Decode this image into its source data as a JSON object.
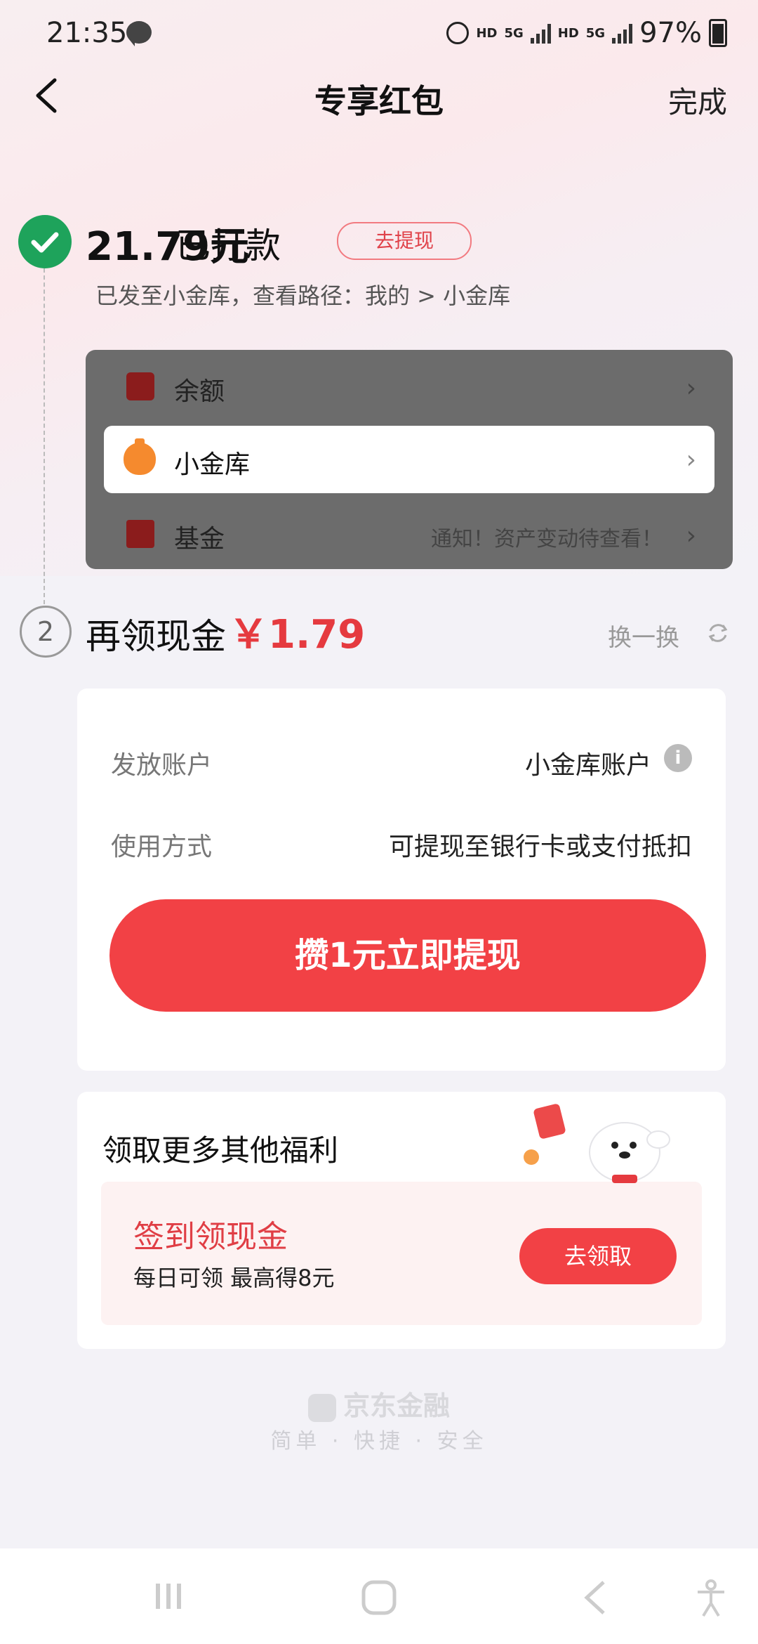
{
  "status_bar": {
    "time": "21:35",
    "hd1": "HD",
    "net1": "5G",
    "hd2": "HD",
    "net2": "5G",
    "battery": "97%"
  },
  "header": {
    "title": "专享红包",
    "done_label": "完成"
  },
  "step1": {
    "amount": "21.79元",
    "status": "已打款",
    "withdraw_tag": "去提现",
    "path_text": "已发至小金库，查看路径：我的 > 小金库",
    "preview_rows": [
      {
        "label": "余额",
        "icon": "wallet-icon",
        "note": ""
      },
      {
        "label": "小金库",
        "icon": "money-bag-icon",
        "note": ""
      },
      {
        "label": "基金",
        "icon": "fund-chart-icon",
        "note": "通知！资产变动待查看！"
      }
    ]
  },
  "step2": {
    "number": "2",
    "title": "再领现金",
    "amount": "￥1.79",
    "refresh_label": "换一换"
  },
  "card": {
    "account_label": "发放账户",
    "account_value": "小金库账户",
    "usage_label": "使用方式",
    "usage_value": "可提现至银行卡或支付抵扣",
    "cta_label": "攒1元立即提现"
  },
  "more": {
    "title": "领取更多其他福利",
    "signin_title": "签到领现金",
    "signin_sub": "每日可领 最高得8元",
    "claim_label": "去领取"
  },
  "footer": {
    "brand": "京东金融",
    "slogan": "简单 · 快捷 · 安全"
  },
  "colors": {
    "accent": "#f24145",
    "success": "#1ea35b"
  }
}
